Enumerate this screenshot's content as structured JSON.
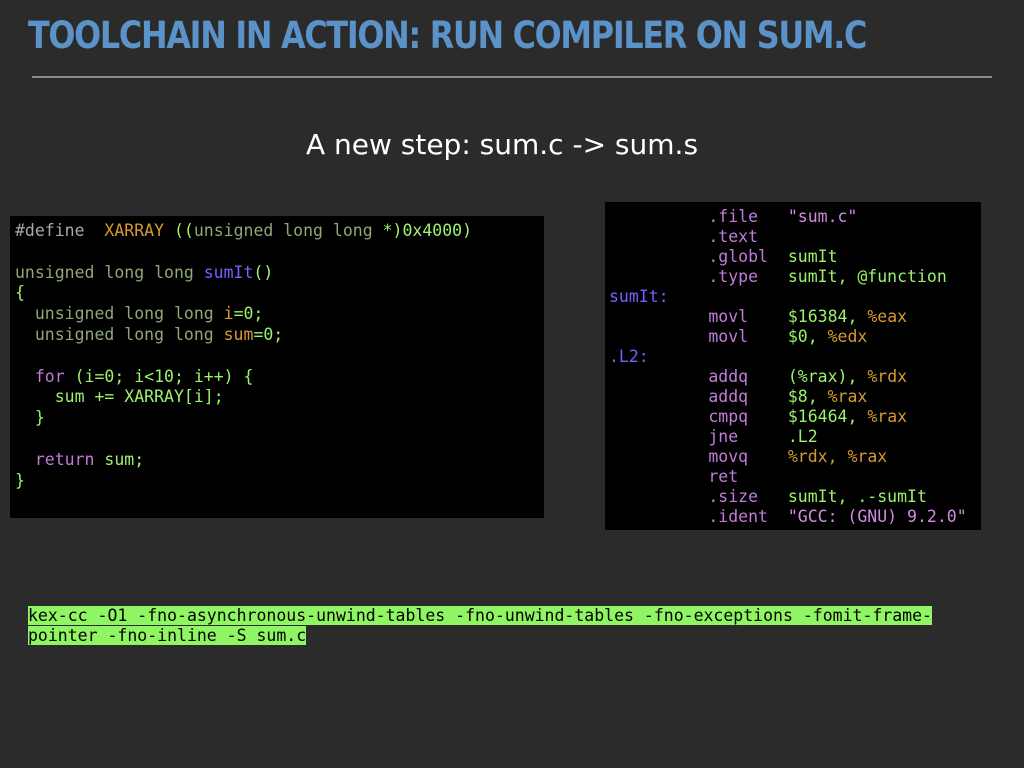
{
  "slide": {
    "title": "TOOLCHAIN IN ACTION: RUN COMPILER ON SUM.C",
    "subtitle": "A new step: sum.c -> sum.s"
  },
  "c_source": {
    "line1": {
      "directive": "#define",
      "macro": "XARRAY",
      "cast_open": "((",
      "cast_type": "unsigned long long",
      "cast_tail": "*)0x4000)"
    },
    "line3": {
      "ret_type": "unsigned long long",
      "func": "sumIt",
      "parens": "()"
    },
    "line4": {
      "brace": "{"
    },
    "line5": {
      "type": "unsigned long long",
      "var": "i",
      "init": "=0;"
    },
    "line6": {
      "type": "unsigned long long",
      "var": "sum",
      "init": "=0;"
    },
    "line8": {
      "kw": "for",
      "rest": "(i=0; i<10; i++) {"
    },
    "line9": {
      "stmt": "sum += XARRAY[i];"
    },
    "line10": {
      "brace": "}"
    },
    "line12": {
      "kw": "return",
      "rest": "sum;"
    },
    "line13": {
      "brace": "}"
    }
  },
  "asm_output": {
    "l1": {
      "op": ".file",
      "args": "\"sum.c\""
    },
    "l2": {
      "op": ".text"
    },
    "l3": {
      "op": ".globl",
      "args": "sumIt"
    },
    "l4": {
      "op": ".type",
      "args": "sumIt, @function"
    },
    "l5": {
      "label": "sumIt:"
    },
    "l6": {
      "op": "movl",
      "a1": "$16384,",
      "a2": "%eax"
    },
    "l7": {
      "op": "movl",
      "a1": "$0,",
      "a2": "%edx"
    },
    "l8": {
      "label": ".L2:"
    },
    "l9": {
      "op": "addq",
      "a1": "(%rax),",
      "a2": "%rdx"
    },
    "l10": {
      "op": "addq",
      "a1": "$8,",
      "a2": "%rax"
    },
    "l11": {
      "op": "cmpq",
      "a1": "$16464,",
      "a2": "%rax"
    },
    "l12": {
      "op": "jne",
      "args": ".L2"
    },
    "l13": {
      "op": "movq",
      "a1": "%rdx,",
      "a2": "%rax"
    },
    "l14": {
      "op": "ret"
    },
    "l15": {
      "op": ".size",
      "args": "sumIt, .-sumIt"
    },
    "l16": {
      "op": ".ident",
      "args": "\"GCC: (GNU) 9.2.0\""
    }
  },
  "command": {
    "line1": "kex-cc -O1 -fno-asynchronous-unwind-tables -fno-unwind-tables -fno-exceptions -fomit-frame-",
    "line2": "pointer -fno-inline -S sum.c"
  },
  "colors": {
    "background": "#2b2b2b",
    "title": "#5b93c9",
    "code_green": "#9cf36b",
    "code_purple": "#c17cd9",
    "code_orange": "#d49a2e",
    "code_blue": "#7f5cff",
    "command_highlight": "#8ff562"
  }
}
